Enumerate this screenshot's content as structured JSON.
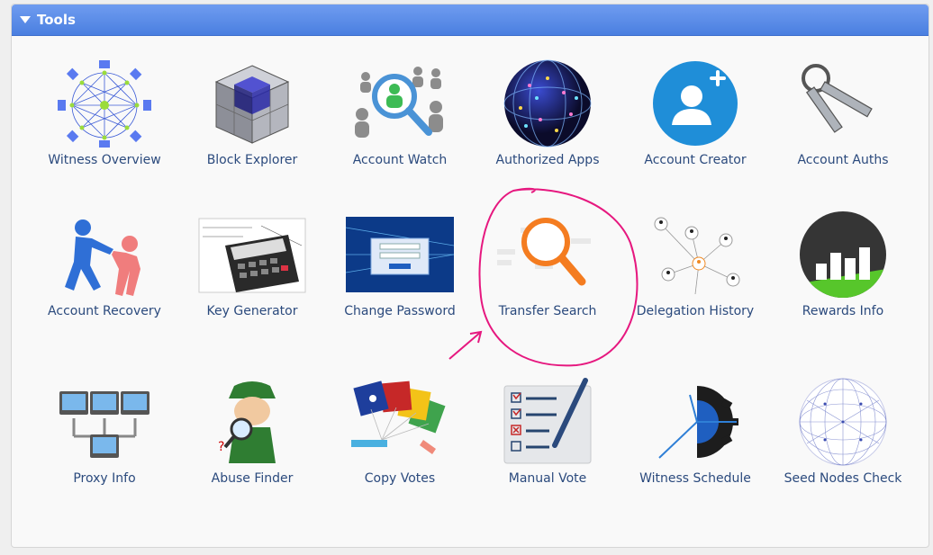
{
  "panel": {
    "title": "Tools"
  },
  "tools": [
    {
      "label": "Witness Overview",
      "icon": "network-icon"
    },
    {
      "label": "Block Explorer",
      "icon": "cube-icon"
    },
    {
      "label": "Account Watch",
      "icon": "magnifier-people-icon"
    },
    {
      "label": "Authorized Apps",
      "icon": "globe-lights-icon"
    },
    {
      "label": "Account Creator",
      "icon": "add-user-icon"
    },
    {
      "label": "Account Auths",
      "icon": "keys-icon"
    },
    {
      "label": "Account Recovery",
      "icon": "helping-hand-icon"
    },
    {
      "label": "Key Generator",
      "icon": "calculator-icon"
    },
    {
      "label": "Change Password",
      "icon": "login-screen-icon"
    },
    {
      "label": "Transfer Search",
      "icon": "search-icon"
    },
    {
      "label": "Delegation History",
      "icon": "delegation-network-icon"
    },
    {
      "label": "Rewards Info",
      "icon": "bar-chart-icon"
    },
    {
      "label": "Proxy Info",
      "icon": "proxy-computers-icon"
    },
    {
      "label": "Abuse Finder",
      "icon": "detective-icon"
    },
    {
      "label": "Copy Votes",
      "icon": "hand-cards-icon"
    },
    {
      "label": "Manual Vote",
      "icon": "checklist-pen-icon"
    },
    {
      "label": "Witness Schedule",
      "icon": "clock-gear-icon"
    },
    {
      "label": "Seed Nodes Check",
      "icon": "sphere-network-icon"
    }
  ],
  "annotation": {
    "color": "#e6187f",
    "highlighted": "Transfer Search"
  }
}
